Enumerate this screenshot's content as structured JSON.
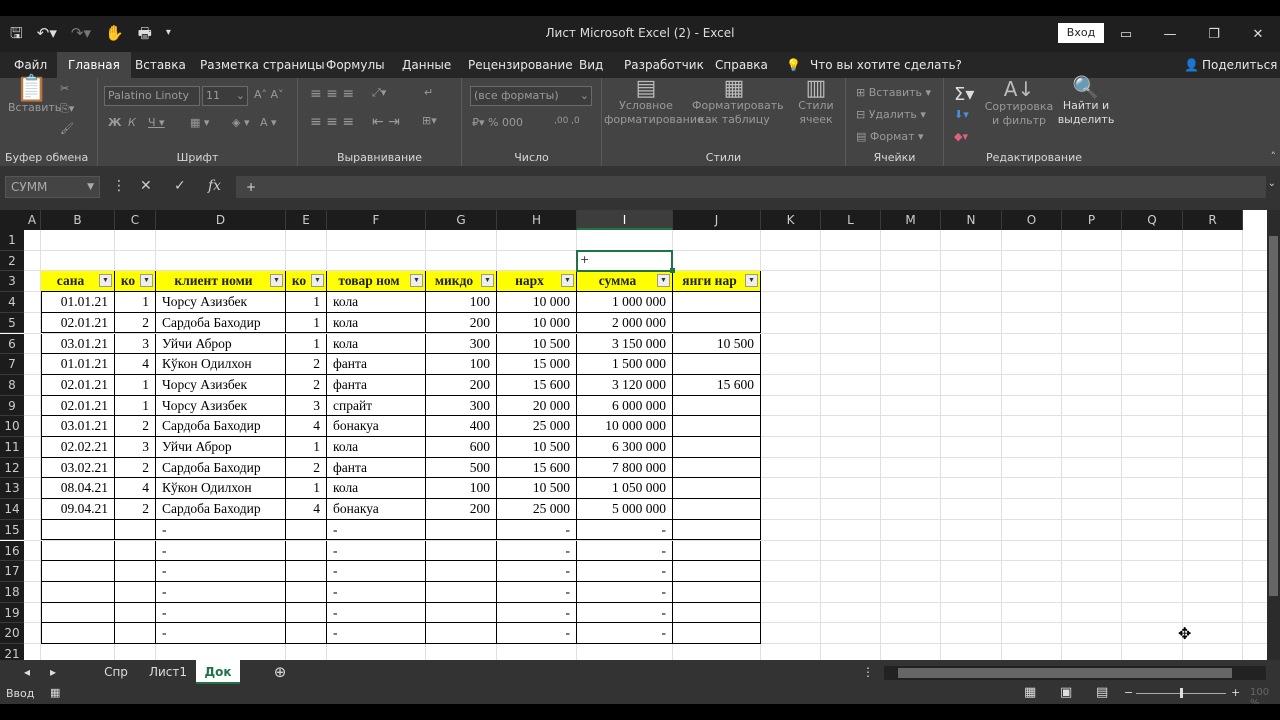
{
  "window": {
    "title": "Лист Microsoft Excel (2)  -  Excel",
    "signin": "Вход"
  },
  "ribbon_tabs": [
    "Файл",
    "Главная",
    "Вставка",
    "Разметка страницы",
    "Формулы",
    "Данные",
    "Рецензирование",
    "Вид",
    "Разработчик",
    "Справка",
    "Что вы хотите сделать?",
    "Поделиться"
  ],
  "ribbon": {
    "clipboard": {
      "paste": "Вставить",
      "label": "Буфер обмена"
    },
    "font": {
      "name": "Palatino Linoty",
      "size": "11",
      "label": "Шрифт"
    },
    "alignment": {
      "label": "Выравнивание"
    },
    "number": {
      "format": "(все форматы)",
      "label": "Число"
    },
    "styles": {
      "conditional": "Условное форматирование",
      "as_table": "Форматировать как таблицу",
      "cell_styles": "Стили ячеек",
      "label": "Стили"
    },
    "cells": {
      "insert": "Вставить",
      "delete": "Удалить",
      "format": "Формат",
      "label": "Ячейки"
    },
    "editing": {
      "sort": "Сортировка и фильтр",
      "find": "Найти и выделить",
      "label": "Редактирование"
    }
  },
  "formula_bar": {
    "name_box": "СУММ",
    "formula": "+"
  },
  "columns": [
    "A",
    "B",
    "C",
    "D",
    "E",
    "F",
    "G",
    "H",
    "I",
    "J",
    "K",
    "L",
    "M",
    "N",
    "O",
    "P",
    "Q",
    "R"
  ],
  "rows": [
    "1",
    "2",
    "3",
    "4",
    "5",
    "6",
    "7",
    "8",
    "9",
    "10",
    "11",
    "12",
    "13",
    "14",
    "15",
    "16",
    "17",
    "18",
    "19",
    "20",
    "21"
  ],
  "active_cell_value": "+",
  "table": {
    "headers": [
      "сана",
      "ко",
      "клиент номи",
      "ко",
      "товар ном",
      "микдо",
      "нарх",
      "сумма",
      "янги нар"
    ],
    "rows": [
      [
        "01.01.21",
        "1",
        "Чорсу Азизбек",
        "1",
        "кола",
        "100",
        "10 000",
        "1 000 000",
        ""
      ],
      [
        "02.01.21",
        "2",
        "Сардоба Баходир",
        "1",
        "кола",
        "200",
        "10 000",
        "2 000 000",
        ""
      ],
      [
        "03.01.21",
        "3",
        "Уйчи Аброр",
        "1",
        "кола",
        "300",
        "10 500",
        "3 150 000",
        "10 500"
      ],
      [
        "01.01.21",
        "4",
        "Кўкон Одилхон",
        "2",
        "фанта",
        "100",
        "15 000",
        "1 500 000",
        ""
      ],
      [
        "02.01.21",
        "1",
        "Чорсу Азизбек",
        "2",
        "фанта",
        "200",
        "15 600",
        "3 120 000",
        "15 600"
      ],
      [
        "02.01.21",
        "1",
        "Чорсу Азизбек",
        "3",
        "спрайт",
        "300",
        "20 000",
        "6 000 000",
        ""
      ],
      [
        "03.01.21",
        "2",
        "Сардоба Баходир",
        "4",
        "бонакуа",
        "400",
        "25 000",
        "10 000 000",
        ""
      ],
      [
        "02.02.21",
        "3",
        "Уйчи Аброр",
        "1",
        "кола",
        "600",
        "10 500",
        "6 300 000",
        ""
      ],
      [
        "03.02.21",
        "2",
        "Сардоба Баходир",
        "2",
        "фанта",
        "500",
        "15 600",
        "7 800 000",
        ""
      ],
      [
        "08.04.21",
        "4",
        "Кўкон Одилхон",
        "1",
        "кола",
        "100",
        "10 500",
        "1 050 000",
        ""
      ],
      [
        "09.04.21",
        "2",
        "Сардоба Баходир",
        "4",
        "бонакуа",
        "200",
        "25 000",
        "5 000 000",
        ""
      ],
      [
        "",
        "",
        "-",
        "",
        "-",
        "",
        "-",
        "-",
        ""
      ],
      [
        "",
        "",
        "-",
        "",
        "-",
        "",
        "-",
        "-",
        ""
      ],
      [
        "",
        "",
        "-",
        "",
        "-",
        "",
        "-",
        "-",
        ""
      ],
      [
        "",
        "",
        "-",
        "",
        "-",
        "",
        "-",
        "-",
        ""
      ],
      [
        "",
        "",
        "-",
        "",
        "-",
        "",
        "-",
        "-",
        ""
      ],
      [
        "",
        "",
        "-",
        "",
        "-",
        "",
        "-",
        "-",
        ""
      ]
    ]
  },
  "sheet_tabs": [
    "Спр",
    "Лист1",
    "Док"
  ],
  "active_sheet": "Док",
  "status": {
    "mode": "Ввод",
    "zoom": "100 %"
  }
}
